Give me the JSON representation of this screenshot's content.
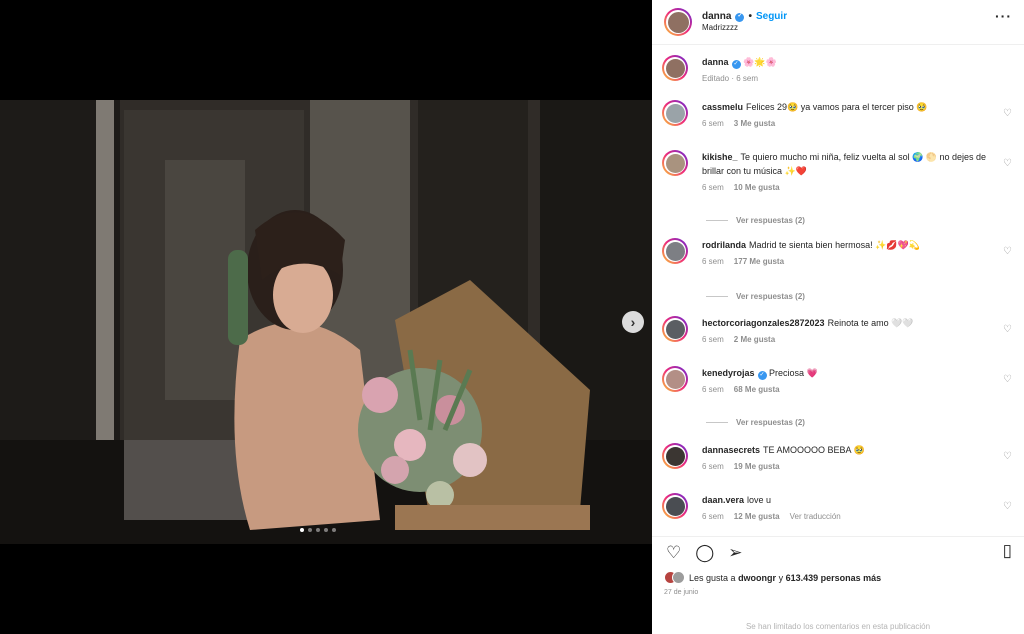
{
  "post": {
    "username": "danna",
    "follow_label": "Seguir",
    "location": "Madrizzzz",
    "more_label": "···",
    "caption_emoji": "🌸🌟🌸",
    "caption_meta": "Editado · 6 sem",
    "carousel": {
      "slides": 5,
      "active_slide": 1
    },
    "next_arrow": "›"
  },
  "comments": [
    {
      "user": "cassmelu",
      "text": "Felices 29🥹 ya vamos para el tercer piso 🥹",
      "time": "6 sem",
      "likes": "3 Me gusta",
      "avatar_color": "#9aa3a8"
    },
    {
      "user": "kikishe_",
      "text": "Te quiero mucho mi niña, feliz vuelta al sol 🌍 🌕 no dejes de brillar con tu música ✨❤️",
      "time": "6 sem",
      "likes": "10 Me gusta",
      "avatar_color": "#a9937f",
      "replies": "Ver respuestas (2)"
    },
    {
      "user": "rodrilanda",
      "text": "Madrid te sienta bien hermosa! ✨💋💖💫",
      "time": "6 sem",
      "likes": "177 Me gusta",
      "avatar_color": "#7d7f84",
      "replies": "Ver respuestas (2)"
    },
    {
      "user": "hectorcoriagonzales2872023",
      "text": "Reinota te amo 🤍🤍",
      "time": "6 sem",
      "likes": "2 Me gusta",
      "avatar_color": "#5b5e63"
    },
    {
      "user": "kenedyrojas",
      "text": "Preciosa 💗",
      "time": "6 sem",
      "likes": "68 Me gusta",
      "avatar_color": "#b38f86",
      "verified": true,
      "replies": "Ver respuestas (2)"
    },
    {
      "user": "dannasecrets",
      "text": "TE AMOOOOO BEBA 🥹",
      "time": "6 sem",
      "likes": "19 Me gusta",
      "avatar_color": "#3b3632"
    },
    {
      "user": "daan.vera",
      "text": "love u",
      "time": "6 sem",
      "likes": "12 Me gusta",
      "extra": "Ver traducción",
      "avatar_color": "#4a4d52"
    }
  ],
  "actions": {
    "like_icon": "heart-outline-icon",
    "comment_icon": "comment-icon",
    "share_icon": "send-icon",
    "save_icon": "bookmark-icon",
    "likes_prefix": "Les gusta a",
    "likes_user": "dwoongr",
    "likes_middle": "y",
    "likes_count": "613.439 personas más",
    "date": "27 de junio",
    "limited_notice": "Se han limitado los comentarios en esta publicación"
  },
  "colors": {
    "accent": "#0095f6",
    "verified": "#3897f0",
    "muted": "#8e8e8e",
    "like_red": "#ed4956"
  }
}
